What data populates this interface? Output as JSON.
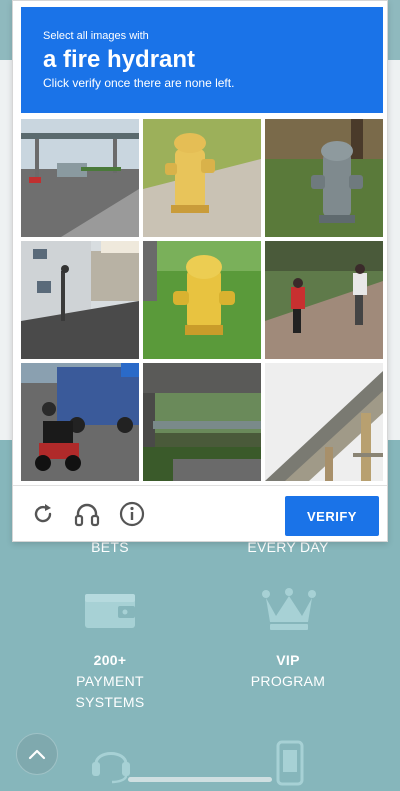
{
  "captcha": {
    "instruction_small": "Select all images with",
    "target_object": "a fire hydrant",
    "instruction_sub": "Click verify once there are none left.",
    "verify_label": "VERIFY",
    "tiles": [
      {
        "subject": "street-overpass"
      },
      {
        "subject": "fire-hydrant-yellow"
      },
      {
        "subject": "fire-hydrant-gray"
      },
      {
        "subject": "street-houses"
      },
      {
        "subject": "fire-hydrant-yellow-grass"
      },
      {
        "subject": "bicycle-path"
      },
      {
        "subject": "motorcycle-truck"
      },
      {
        "subject": "bridge-under"
      },
      {
        "subject": "highway-overpass"
      }
    ],
    "icons": {
      "reload": "reload-icon",
      "audio": "headphones-icon",
      "info": "info-icon"
    },
    "colors": {
      "accent": "#1a73e8"
    }
  },
  "background": {
    "bets_label": "BETS",
    "every_day_label": "EVERY DAY",
    "payment_count": "200+",
    "payment_label_1": "PAYMENT",
    "payment_label_2": "SYSTEMS",
    "vip_label": "VIP",
    "program_label": "PROGRAM",
    "colors": {
      "teal": "#86b6bb"
    }
  }
}
